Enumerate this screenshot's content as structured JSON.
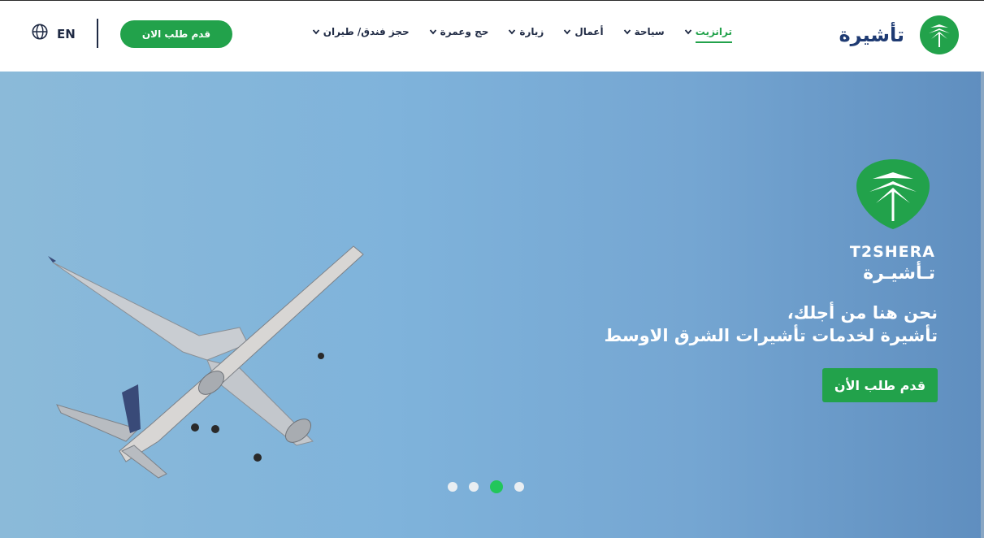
{
  "header": {
    "lang_label": "EN",
    "cta_label": "قدم طلب الان",
    "brand_name": "تأشيرة",
    "nav": [
      {
        "label": "ترانزيت",
        "active": true
      },
      {
        "label": "سياحة",
        "active": false
      },
      {
        "label": "أعمال",
        "active": false
      },
      {
        "label": "زيارة",
        "active": false
      },
      {
        "label": "حج وعمرة",
        "active": false
      },
      {
        "label": "حجز فندق/ طيران",
        "active": false
      }
    ]
  },
  "hero": {
    "brand_en": "T2SHERA",
    "brand_ar": "تـأشيـرة",
    "line1": "نحن هنا من أجلك،",
    "line2": "تأشيرة لخدمات تأشيرات الشرق الاوسط",
    "cta_label": "قدم طلب الأن",
    "slides": 4,
    "active_slide": 3
  },
  "colors": {
    "accent": "#22a24b",
    "nav_text": "#1f2a44",
    "brand_blue": "#1f3b73"
  }
}
